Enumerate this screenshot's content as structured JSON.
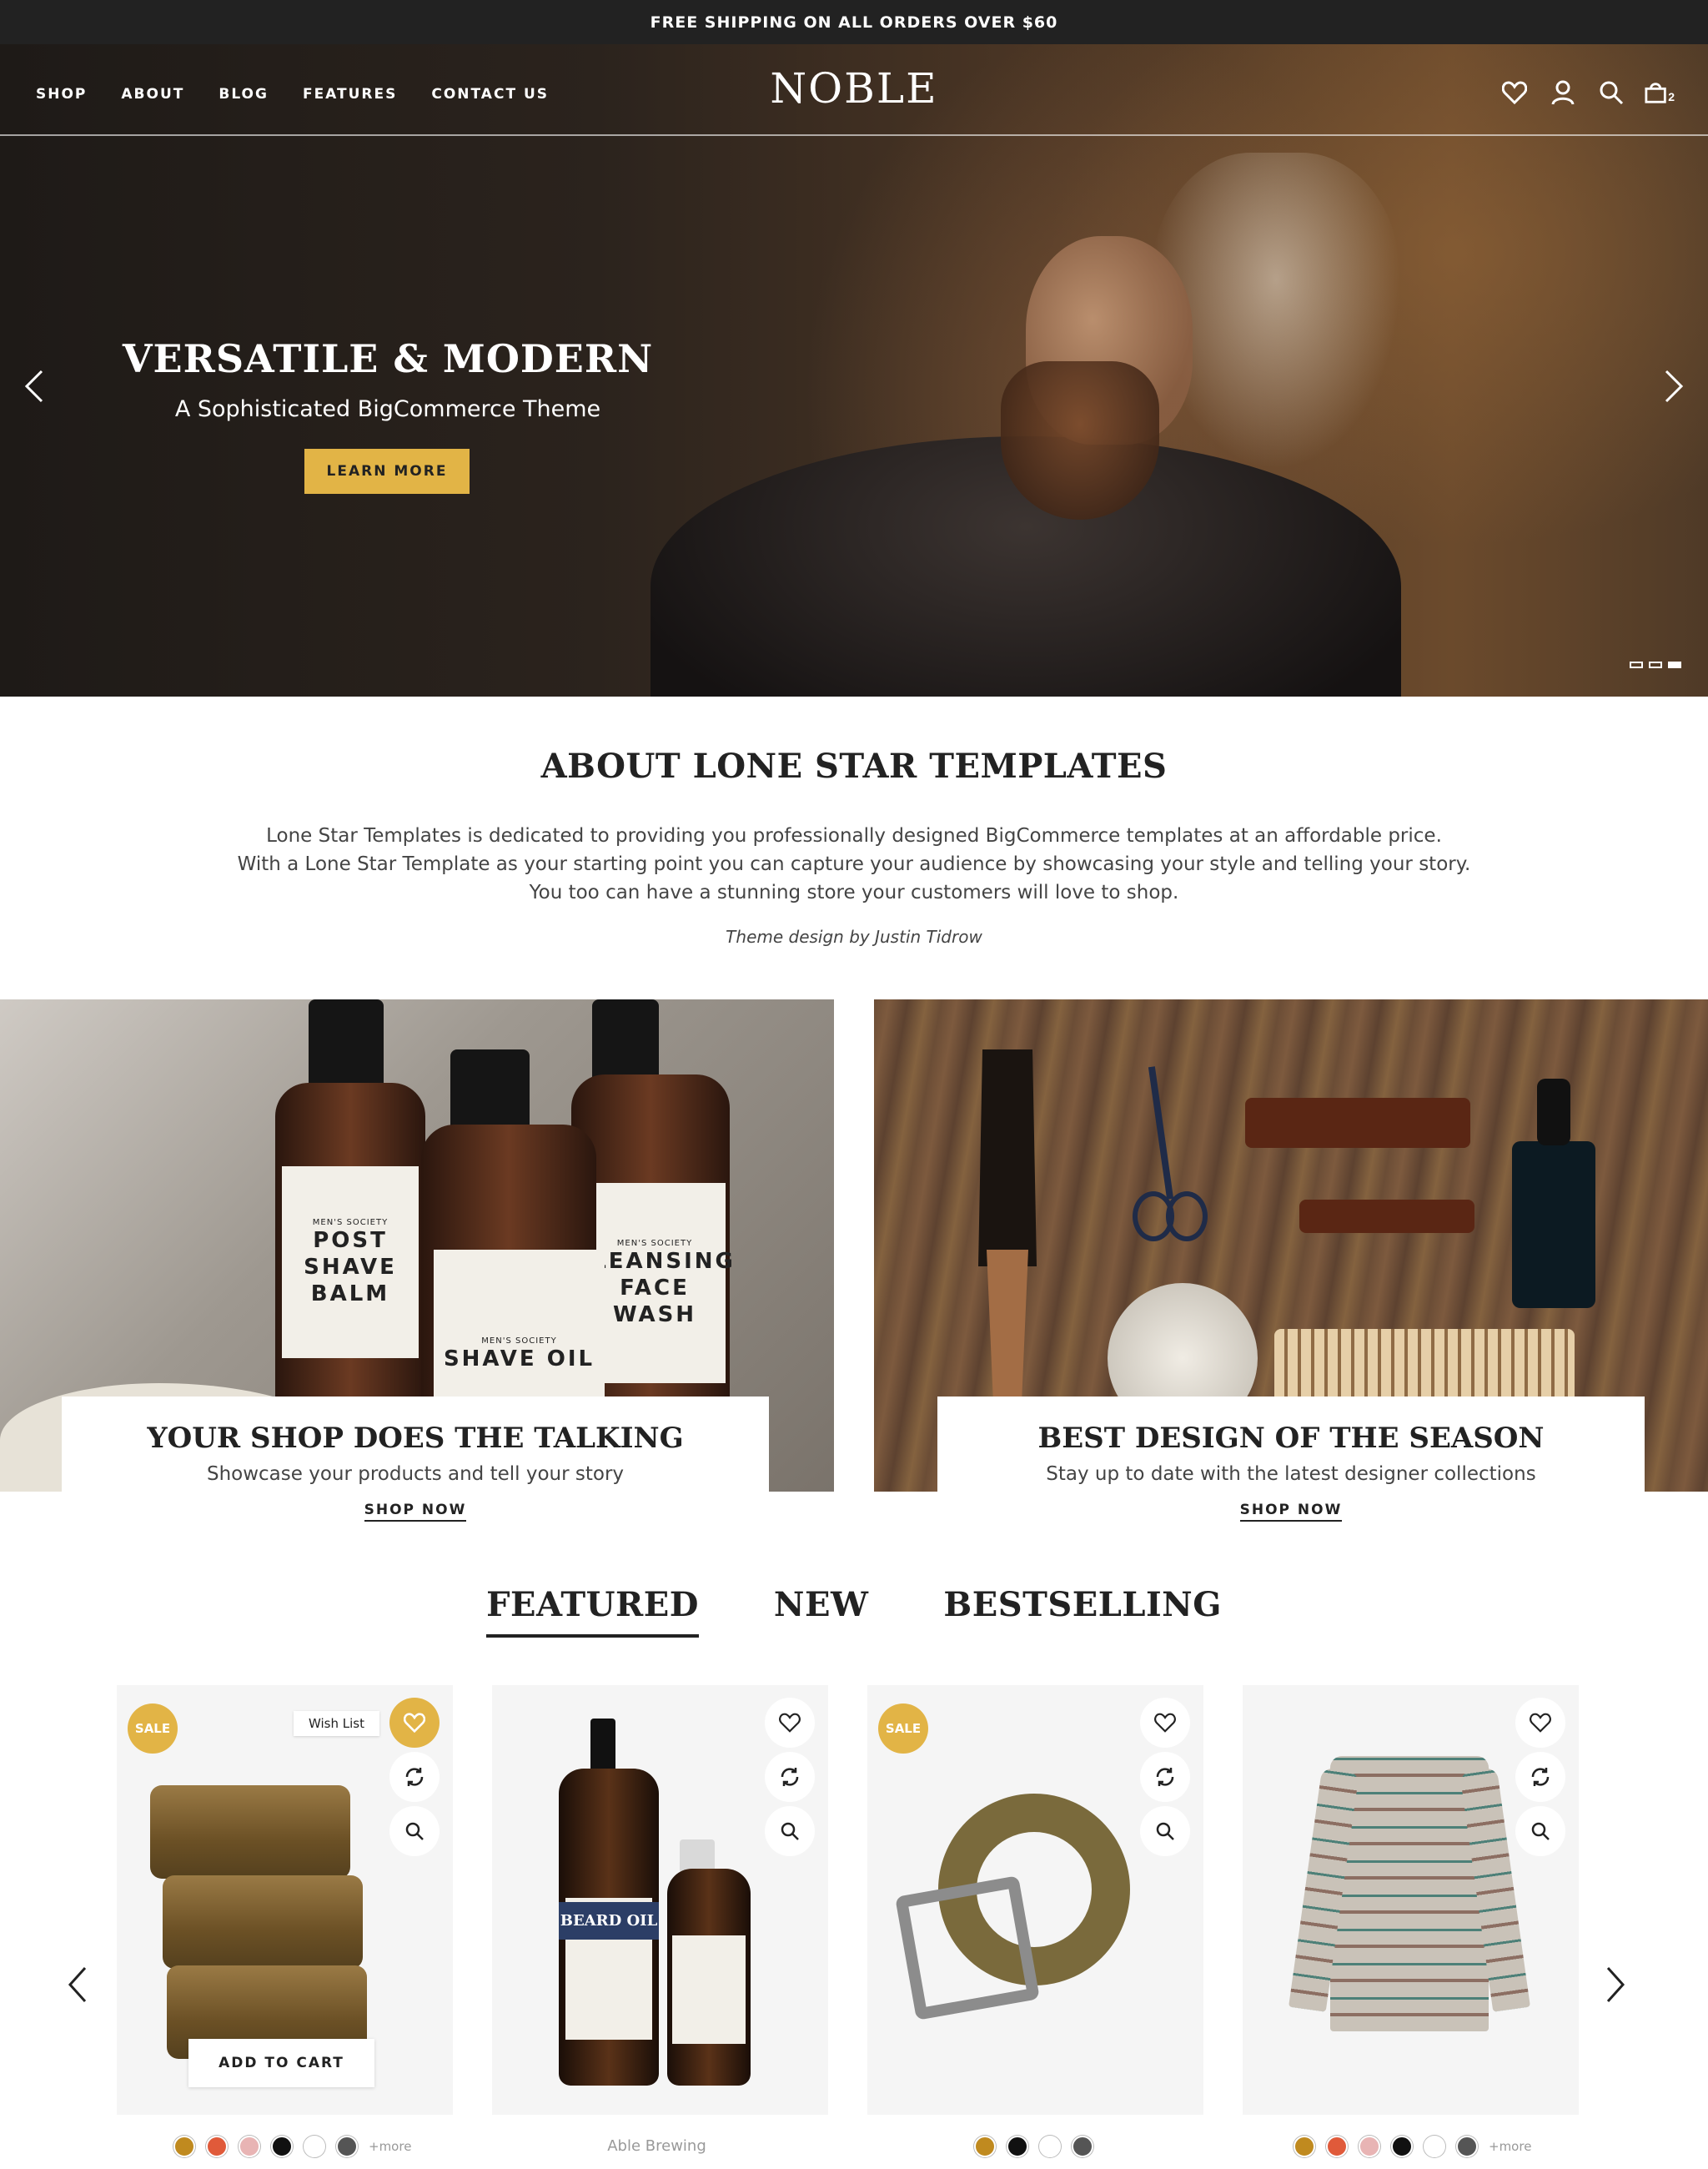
{
  "announcement": "FREE SHIPPING ON ALL ORDERS OVER $60",
  "nav": {
    "links": [
      "SHOP",
      "ABOUT",
      "BLOG",
      "FEATURES",
      "CONTACT US"
    ],
    "logo": "NOBLE",
    "icons": [
      "heart-icon",
      "user-icon",
      "search-icon",
      "bag-icon"
    ],
    "cart_count": "2"
  },
  "hero": {
    "title": "VERSATILE & MODERN",
    "subtitle": "A Sophisticated BigCommerce Theme",
    "button": "LEARN MORE",
    "slides_total": 3,
    "active_slide": 3
  },
  "about": {
    "title": "ABOUT LONE STAR TEMPLATES",
    "lines": [
      "Lone Star Templates is dedicated to providing you professionally designed BigCommerce templates at an affordable price.",
      "With a Lone Star Template as your starting point you can capture your audience by showcasing your style and telling your story.",
      "You too can have a stunning store your customers will love to shop."
    ],
    "credit": "Theme design by Justin Tidrow"
  },
  "promos": [
    {
      "title": "YOUR SHOP DOES THE TALKING",
      "subtitle": "Showcase your products and tell your story",
      "link": "SHOP NOW",
      "bottle_labels": [
        {
          "small": "MEN'S SOCIETY",
          "big": "POST SHAVE BALM"
        },
        {
          "small": "MEN'S SOCIETY",
          "big": "SHAVE OIL"
        },
        {
          "small": "MEN'S SOCIETY",
          "big": "CLEANSING FACE WASH"
        }
      ]
    },
    {
      "title": "BEST DESIGN OF THE SEASON",
      "subtitle": "Stay up to date with the latest designer collections",
      "link": "SHOP NOW"
    }
  ],
  "tabs": [
    {
      "label": "FEATURED",
      "active": true
    },
    {
      "label": "NEW",
      "active": false
    },
    {
      "label": "BESTSELLING",
      "active": false
    }
  ],
  "products": [
    {
      "sale": "SALE",
      "tooltip": "Wish List",
      "cta": "ADD TO CART",
      "wishlist_active": true,
      "swatches": [
        "#c08a1f",
        "#e05a3a",
        "#e8b4b4",
        "#111111",
        "#ffffff",
        "#555555"
      ],
      "more": "+more"
    },
    {
      "brand": "Able Brewing",
      "image_text": "BEARD OIL"
    },
    {
      "sale": "SALE",
      "swatches": [
        "#c08a1f",
        "#111111",
        "#ffffff",
        "#555555"
      ]
    },
    {
      "swatches": [
        "#c08a1f",
        "#e05a3a",
        "#e8b4b4",
        "#111111",
        "#ffffff",
        "#555555"
      ],
      "more": "+more"
    }
  ],
  "colors": {
    "accent": "#e2b446",
    "dark": "#222222",
    "card_bg": "#f5f5f5"
  }
}
